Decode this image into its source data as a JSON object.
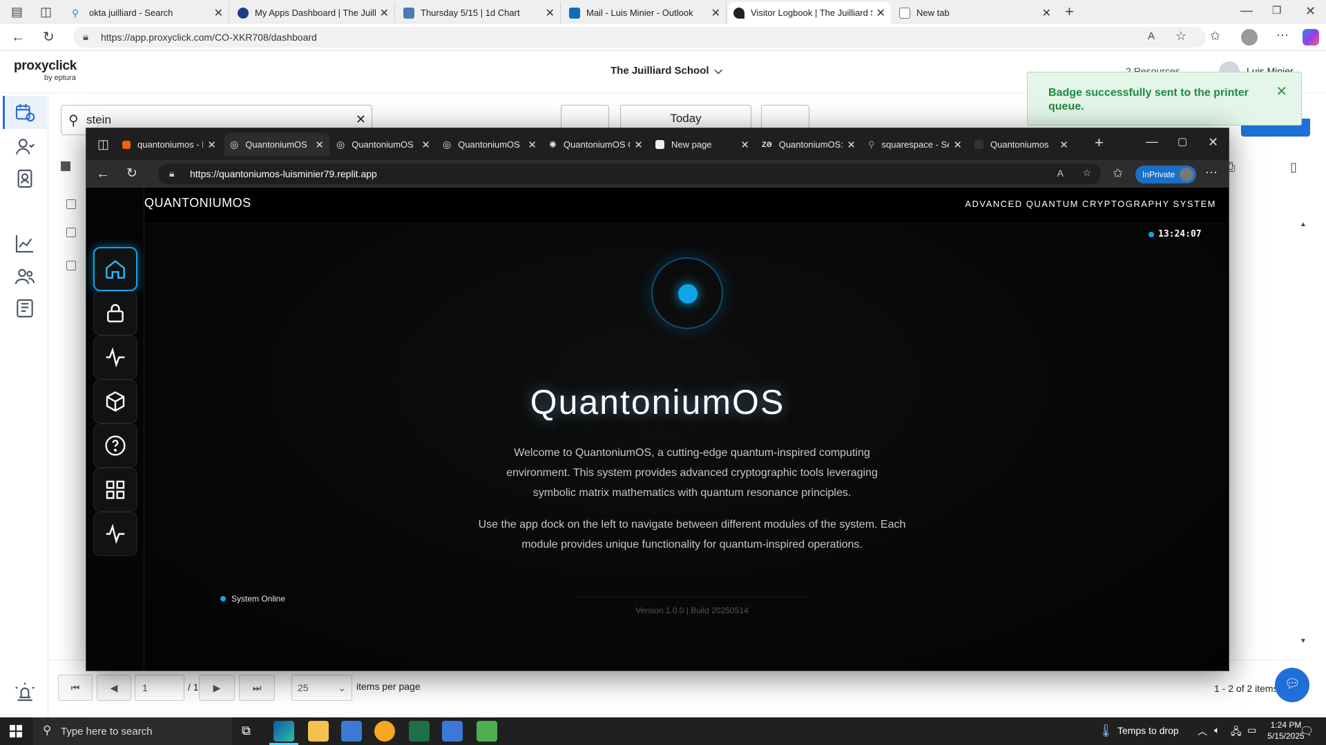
{
  "outer_browser": {
    "tabs": [
      {
        "title": "okta juilliard - Search",
        "favicon_color": "#2f7bd8"
      },
      {
        "title": "My Apps Dashboard | The Juilliard",
        "favicon_color": "#1f3c88"
      },
      {
        "title": "Thursday 5/15 | 1d Chart",
        "favicon_color": "#4a7ab8"
      },
      {
        "title": "Mail - Luis Minier - Outlook",
        "favicon_color": "#0f6cbd"
      },
      {
        "title": "Visitor Logbook | The Juilliard Sch",
        "favicon_color": "#222222",
        "active": true
      },
      {
        "title": "New tab",
        "favicon_color": "#777777"
      }
    ],
    "url": "https://app.proxyclick.com/CO-XKR708/dashboard"
  },
  "proxyclick": {
    "brand": "proxyclick",
    "brand_sub": "by eptura",
    "org": "The Juilliard School",
    "resources": "Resources",
    "user": "Luis Minier",
    "search_value": "stein",
    "date_label": "Today",
    "toast": "Badge successfully sent to the printer queue.",
    "pagination": {
      "page": "1",
      "of": "/ 1",
      "per_page": "25",
      "per_page_label": "items per page",
      "summary": "1 - 2 of 2 items"
    }
  },
  "inner_browser": {
    "tabs": [
      {
        "title": "quantoniumos - R",
        "active": false
      },
      {
        "title": "QuantoniumOS",
        "active": true
      },
      {
        "title": "QuantoniumOS",
        "active": false
      },
      {
        "title": "QuantoniumOS",
        "active": false
      },
      {
        "title": "QuantoniumOS C",
        "active": false
      },
      {
        "title": "New page",
        "active": false
      },
      {
        "title": "QuantoniumOS: A",
        "active": false
      },
      {
        "title": "squarespace - Se",
        "active": false
      },
      {
        "title": "Quantoniumos",
        "active": false
      }
    ],
    "url": "https://quantoniumos-luisminier79.replit.app",
    "inprivate": "InPrivate"
  },
  "app": {
    "brand": "QUANTONIUMOS",
    "tagline": "ADVANCED QUANTUM CRYPTOGRAPHY SYSTEM",
    "clock": "13:24:07",
    "title": "QuantoniumOS",
    "intro": "Welcome to QuantoniumOS, a cutting-edge quantum-inspired computing environment. This system provides advanced cryptographic tools leveraging symbolic matrix mathematics with quantum resonance principles.",
    "nav_hint": "Use the app dock on the left to navigate between different modules of the system. Each module provides unique functionality for quantum-inspired operations.",
    "status": "System Online",
    "version": "Version 1.0.0 | Build 20250514",
    "accent_color": "#0ea5e9",
    "dock": [
      "home-icon",
      "lock-icon",
      "pulse-icon",
      "cube-icon",
      "help-icon",
      "grid-icon",
      "pulse-icon"
    ]
  },
  "taskbar": {
    "search_placeholder": "Type here to search",
    "weather": "Temps to drop",
    "time": "1:24 PM",
    "date": "5/15/2025"
  }
}
